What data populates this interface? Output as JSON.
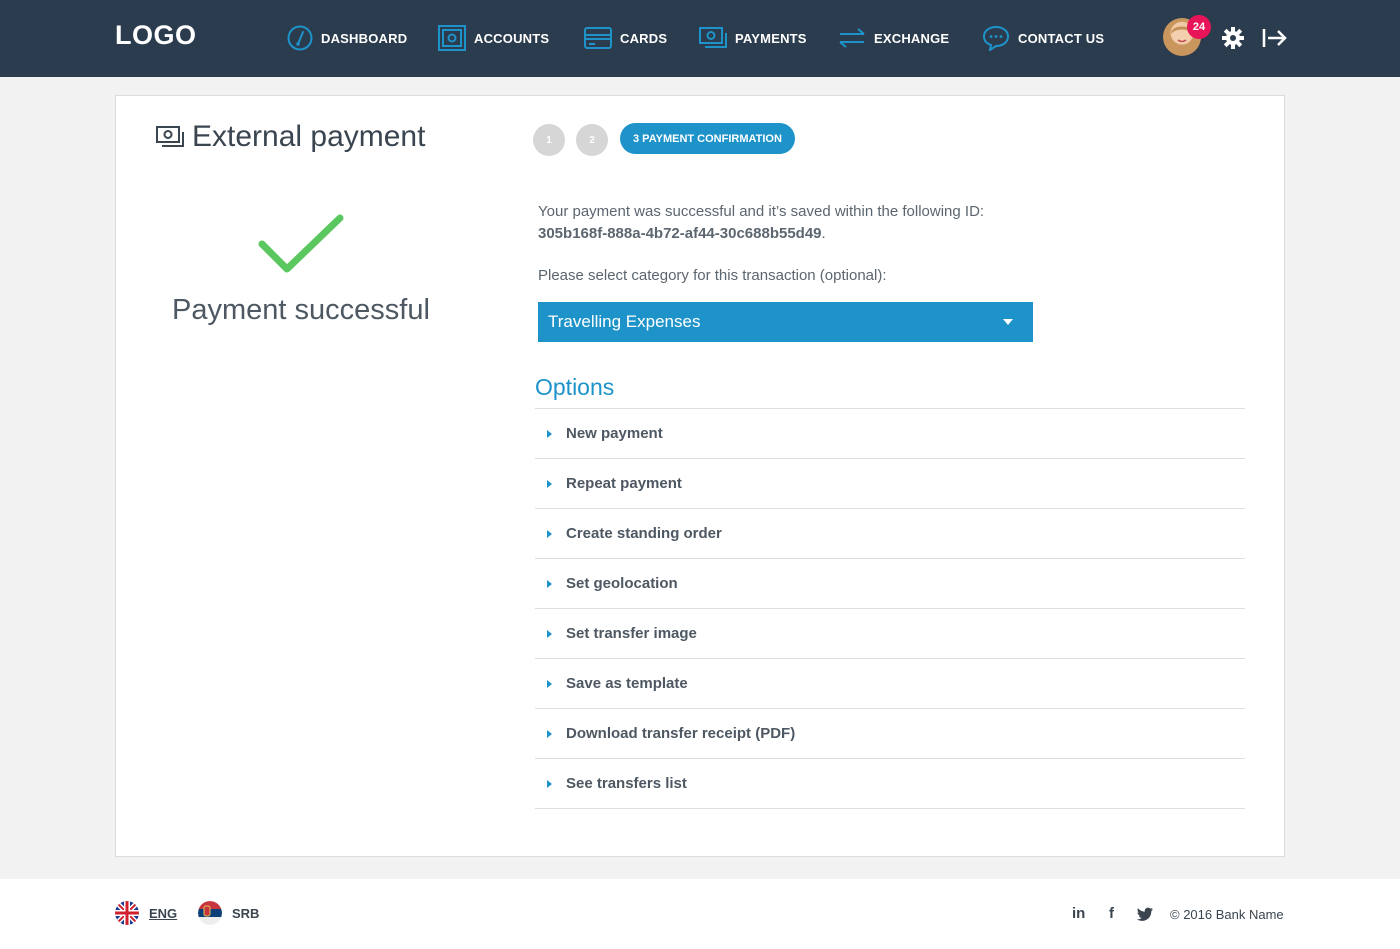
{
  "brand": {
    "logo": "LOGO",
    "primary": "#1e93c9",
    "header_bg": "#2b3c4e",
    "success": "#5ac85e",
    "badge_bg": "#e8145a"
  },
  "nav": {
    "items": [
      {
        "label": "DASHBOARD",
        "icon": "gauge-icon"
      },
      {
        "label": "ACCOUNTS",
        "icon": "safe-icon"
      },
      {
        "label": "CARDS",
        "icon": "card-icon"
      },
      {
        "label": "PAYMENTS",
        "icon": "money-icon"
      },
      {
        "label": "EXCHANGE",
        "icon": "exchange-arrows-icon"
      },
      {
        "label": "CONTACT US",
        "icon": "chat-bubble-icon"
      }
    ],
    "notifications": "24"
  },
  "page": {
    "title": "External payment",
    "title_icon": "money-icon"
  },
  "steps": {
    "step1": "1",
    "step2": "2",
    "active_label": "3 PAYMENT CONFIRMATION"
  },
  "result": {
    "status": "Payment successful",
    "message": "Your payment was successful and it’s saved within the following ID:",
    "transaction_id": "305b168f-888a-4b72-af44-30c688b55d49",
    "id_suffix": "."
  },
  "category": {
    "label": "Please select category for this transaction (optional):",
    "selected": "Travelling Expenses"
  },
  "options": {
    "title": "Options",
    "items": [
      "New payment",
      "Repeat payment",
      "Create standing order",
      "Set geolocation",
      "Set transfer image",
      "Save as template",
      "Download transfer receipt (PDF)",
      "See transfers list"
    ]
  },
  "footer": {
    "languages": [
      {
        "code": "ENG",
        "icon": "uk-flag-icon"
      },
      {
        "code": "SRB",
        "icon": "serbia-flag-icon"
      }
    ],
    "social": {
      "linkedin": "in",
      "facebook": "f"
    },
    "copyright": "© 2016 Bank Name"
  }
}
